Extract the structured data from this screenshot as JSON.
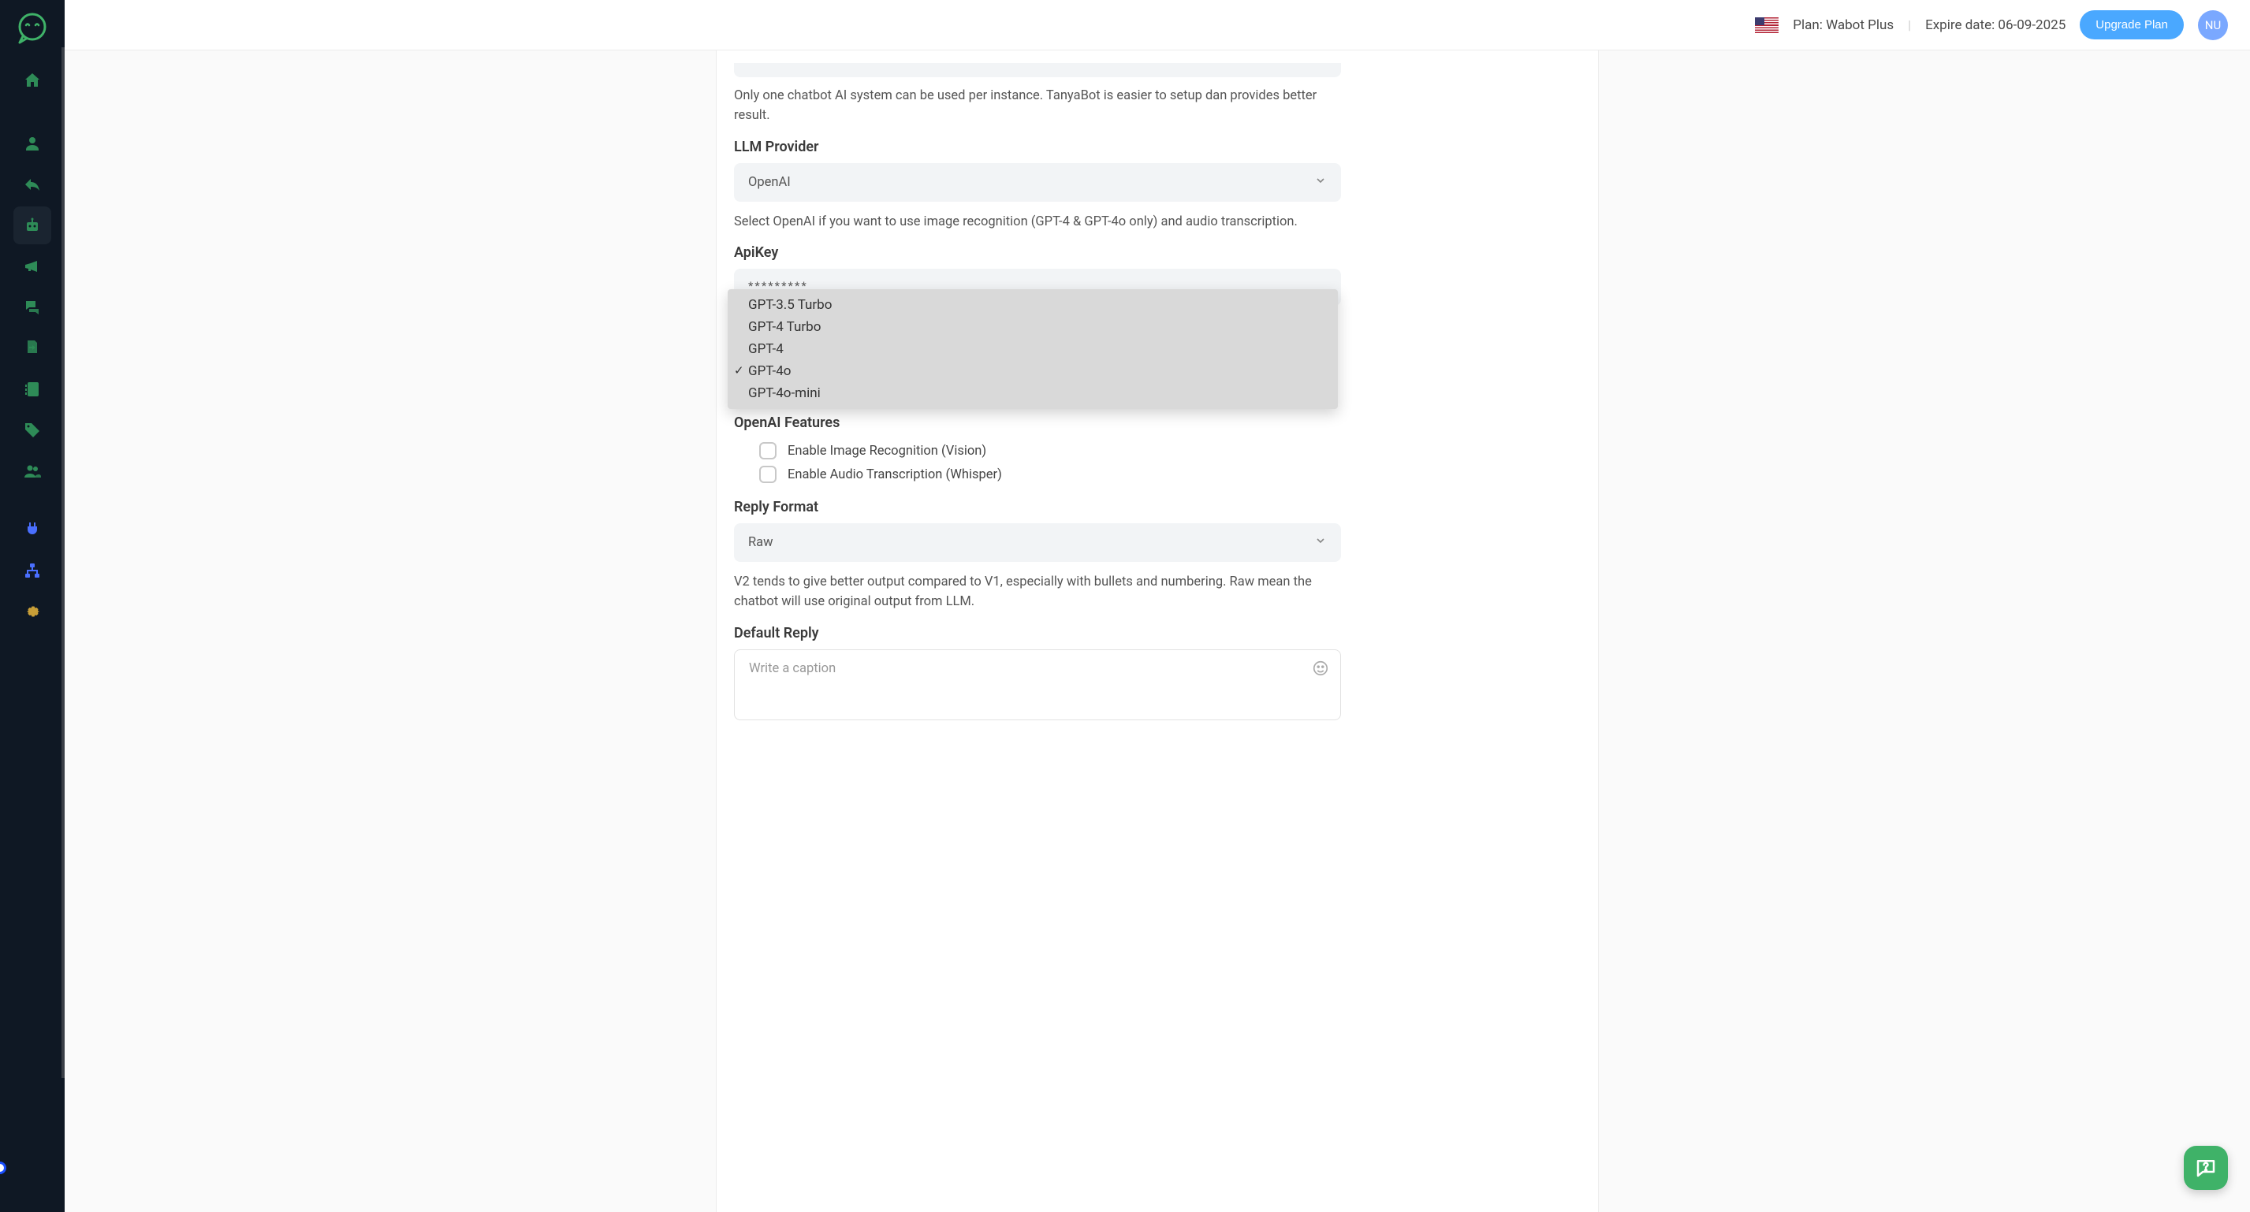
{
  "header": {
    "plan_label": "Plan: Wabot Plus",
    "expire_label": "Expire date: 06-09-2025",
    "upgrade_label": "Upgrade Plan",
    "avatar_initials": "NU"
  },
  "form": {
    "chatbot_note": "Only one chatbot AI system can be used per instance. TanyaBot is easier to setup dan provides better result.",
    "llm_provider_label": "LLM Provider",
    "llm_provider_value": "OpenAI",
    "llm_provider_note": "Select OpenAI if you want to use image recognition (GPT-4 & GPT-4o only) and audio transcription.",
    "apikey_label": "ApiKey",
    "apikey_value": "*********",
    "features_label": "OpenAI Features",
    "feature_vision": "Enable Image Recognition (Vision)",
    "feature_whisper": "Enable Audio Transcription (Whisper)",
    "reply_format_label": "Reply Format",
    "reply_format_value": "Raw",
    "reply_format_note": "V2 tends to give better output compared to V1, especially with bullets and numbering. Raw mean the chatbot will use original output from LLM.",
    "default_reply_label": "Default Reply",
    "default_reply_placeholder": "Write a caption"
  },
  "model_dropdown": {
    "options": [
      "GPT-3.5 Turbo",
      "GPT-4 Turbo",
      "GPT-4",
      "GPT-4o",
      "GPT-4o-mini"
    ],
    "selected": "GPT-4o"
  }
}
